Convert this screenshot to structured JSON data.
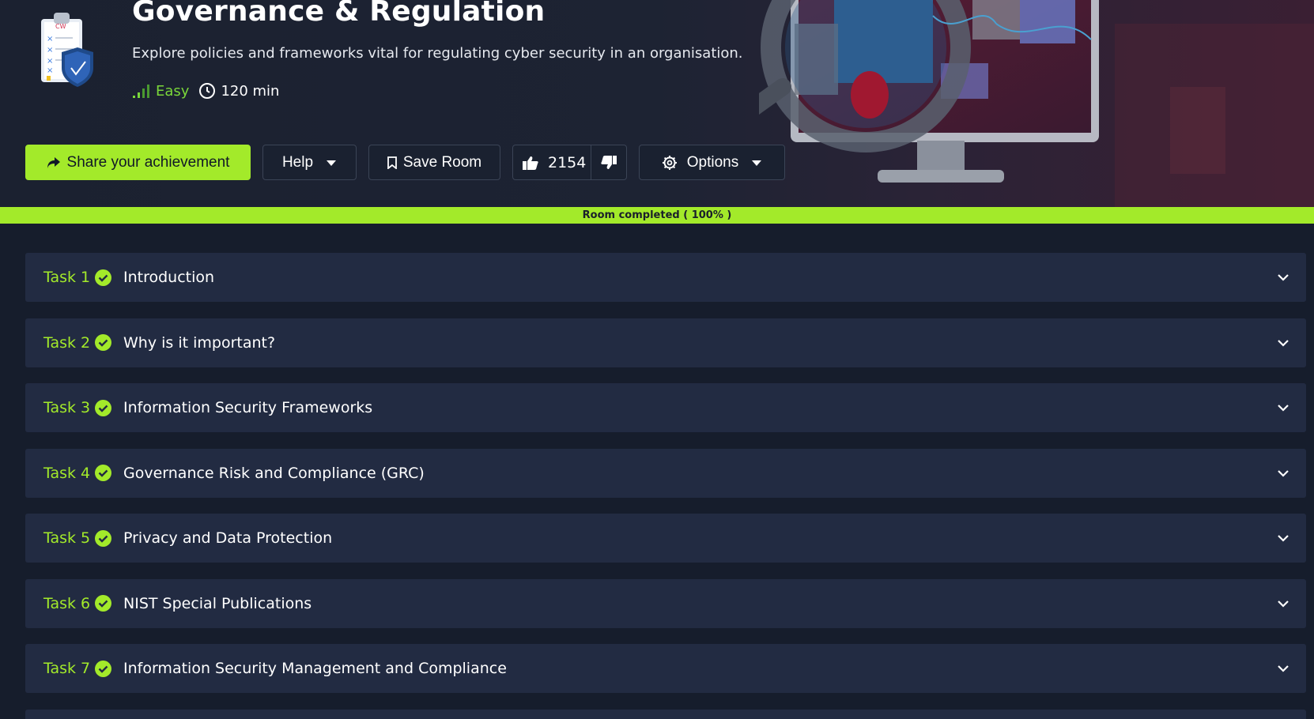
{
  "room": {
    "title": "Governance & Regulation",
    "subtitle": "Explore policies and frameworks vital for regulating cyber security in an organisation.",
    "difficulty": "Easy",
    "duration": "120 min",
    "icon": "clipboard-shield-icon"
  },
  "actions": {
    "share_label": "Share your achievement",
    "help_label": "Help",
    "save_label": "Save Room",
    "likes": "2154",
    "options_label": "Options"
  },
  "progress": {
    "label": "Room completed ( 100% )",
    "percent": 100
  },
  "tasks": [
    {
      "number": "Task 1",
      "title": "Introduction",
      "completed": true
    },
    {
      "number": "Task 2",
      "title": "Why is it important?",
      "completed": true
    },
    {
      "number": "Task 3",
      "title": "Information Security Frameworks",
      "completed": true
    },
    {
      "number": "Task 4",
      "title": "Governance Risk and Compliance (GRC)",
      "completed": true
    },
    {
      "number": "Task 5",
      "title": "Privacy and Data Protection",
      "completed": true
    },
    {
      "number": "Task 6",
      "title": "NIST Special Publications",
      "completed": true
    },
    {
      "number": "Task 7",
      "title": "Information Security Management and Compliance",
      "completed": true
    }
  ],
  "colors": {
    "accent": "#a3ea2a",
    "background": "#161d2c",
    "task_card": "#222b42"
  }
}
